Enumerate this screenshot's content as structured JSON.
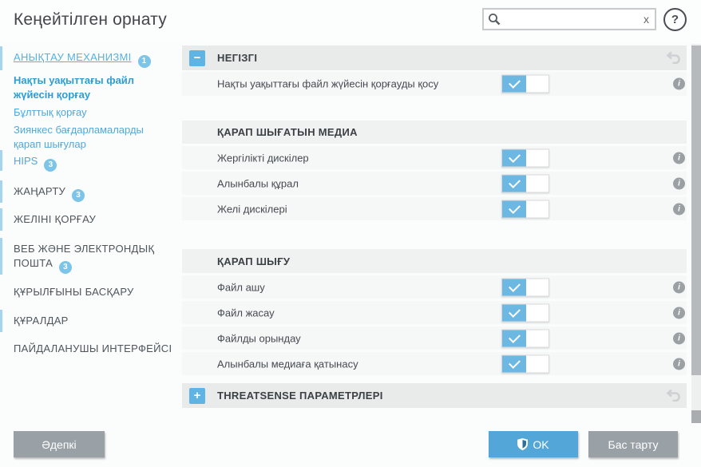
{
  "window": {
    "title": "Кеңейтілген орнату"
  },
  "search": {
    "value": "",
    "placeholder": ""
  },
  "icons": {
    "search": "magnifier-svg",
    "clear": "x",
    "help": "?",
    "collapse": "−",
    "expand": "+",
    "info": "i",
    "reset": "undo-arrow-svg",
    "toggle_check": "white-checkmark-svg",
    "ok_shield": "shield-svg"
  },
  "sidebar": {
    "items": [
      {
        "label": "АНЫҚТАУ МЕХАНИЗМІ",
        "badge": "1",
        "active_section": true
      },
      {
        "label": "Нақты уақыттағы файл жүйесін қорғау",
        "active": true
      },
      {
        "label": "Бұлттық қорғау"
      },
      {
        "label": "Зиянкес бағдарламаларды қарап шығулар"
      },
      {
        "label": "HIPS",
        "badge": "3"
      },
      {
        "label": "ЖАҢАРТУ",
        "badge": "3"
      },
      {
        "label": "ЖЕЛІНІ ҚОРҒАУ"
      },
      {
        "label": "ВЕБ ЖӘНЕ ЭЛЕКТРОНДЫҚ ПОШТА",
        "badge": "3"
      },
      {
        "label": "ҚҰРЫЛҒЫНЫ БАСҚАРУ"
      },
      {
        "label": "ҚҰРАЛДАР"
      },
      {
        "label": "ПАЙДАЛАНУШЫ ИНТЕРФЕЙСІ"
      }
    ]
  },
  "content": {
    "general": {
      "label": "НЕГІЗГІ",
      "collapsed": false,
      "rows": [
        {
          "label": "Нақты уақыттағы файл жүйесін қорғауды қосу",
          "enabled": true
        }
      ]
    },
    "scan_media": {
      "label": "ҚАРАП ШЫҒАТЫН МЕДИА",
      "rows": [
        {
          "label": "Жергілікті дискілер",
          "enabled": true
        },
        {
          "label": "Алынбалы құрал",
          "enabled": true
        },
        {
          "label": "Желі дискілері",
          "enabled": true
        }
      ]
    },
    "scan_on": {
      "label": "ҚАРАП ШЫҒУ",
      "rows": [
        {
          "label": "Файл ашу",
          "enabled": true
        },
        {
          "label": "Файл жасау",
          "enabled": true
        },
        {
          "label": "Файлды орындау",
          "enabled": true
        },
        {
          "label": "Алынбалы медиаға қатынасу",
          "enabled": true
        }
      ]
    },
    "threatsense": {
      "label": "THREATSENSE ПАРАМЕТРЛЕРІ",
      "collapsed": true
    }
  },
  "footer": {
    "default_label": "Әдепкі",
    "ok_label": "OK",
    "cancel_label": "Бас тарту"
  },
  "colors": {
    "accent_blue": "#5fb4e3",
    "toggle_blue": "#6db8e2",
    "badge_blue": "#7cc4e8",
    "link_blue": "#4fa9dc",
    "ok_button": "#53a7d8",
    "gray_button": "#99a0a6",
    "header_row": "#e9eaea",
    "sub_header_row": "#f0f1f1",
    "row_bg": "#f6f7f7"
  }
}
